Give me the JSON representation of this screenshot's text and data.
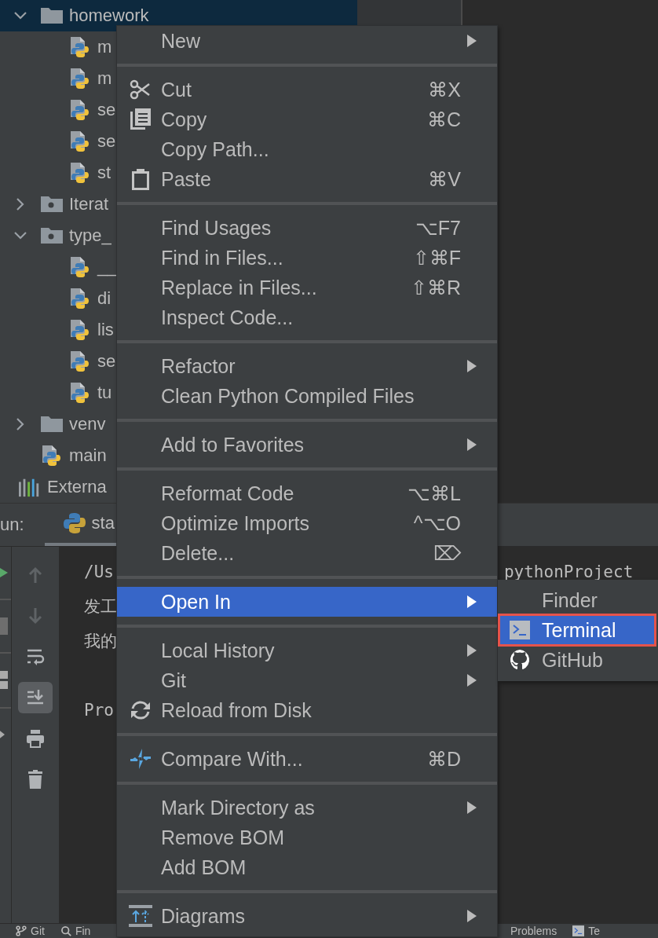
{
  "project_tree": {
    "rows": [
      {
        "label": "homework",
        "kind": "folder",
        "expanded": true,
        "selected": true,
        "children": [
          {
            "label": "m",
            "kind": "python-file",
            "selected": false
          },
          {
            "label": "m",
            "kind": "python-file",
            "selected": false
          },
          {
            "label": "se",
            "kind": "python-file",
            "selected": false
          },
          {
            "label": "se",
            "kind": "python-file",
            "selected": false
          },
          {
            "label": "st",
            "kind": "python-file",
            "selected": false
          }
        ]
      },
      {
        "label": "Iterat",
        "kind": "package",
        "expanded": false,
        "selected": false
      },
      {
        "label": "type_",
        "kind": "package",
        "expanded": true,
        "selected": false,
        "children": [
          {
            "label": "__",
            "kind": "python-file",
            "selected": false
          },
          {
            "label": "di",
            "kind": "python-file",
            "selected": false
          },
          {
            "label": "lis",
            "kind": "python-file",
            "selected": false
          },
          {
            "label": "se",
            "kind": "python-file",
            "selected": false
          },
          {
            "label": "tu",
            "kind": "python-file",
            "selected": false
          }
        ]
      },
      {
        "label": "venv",
        "kind": "folder",
        "expanded": false,
        "selected": false
      },
      {
        "label": "main",
        "kind": "python-file",
        "selected": false
      },
      {
        "label": "Externa",
        "kind": "libraries",
        "selected": false
      }
    ]
  },
  "run_panel": {
    "label": "un:",
    "tab": "sta",
    "toolbar": [
      {
        "kind": "up",
        "disabled": true
      },
      {
        "kind": "down",
        "disabled": true
      },
      {
        "kind": "wrap",
        "on": false
      },
      {
        "kind": "scroll-end",
        "on": true
      },
      {
        "kind": "print",
        "on": false
      },
      {
        "kind": "trash",
        "on": false
      }
    ],
    "console_lines": [
      {
        "text": "/Us",
        "tail": "pythonProject"
      },
      {
        "text": "发工"
      },
      {
        "text": "我的"
      },
      {
        "text": "Pro",
        "blank_before": true
      }
    ]
  },
  "context_menu": {
    "sections": [
      [
        {
          "label": "New",
          "submenu": true,
          "selected": false
        }
      ],
      [
        {
          "label": "Cut",
          "kind": "cut",
          "shortcut": "⌘X",
          "selected": false
        },
        {
          "label": "Copy",
          "kind": "copy",
          "shortcut": "⌘C",
          "selected": false
        },
        {
          "label": "Copy Path...",
          "selected": false
        },
        {
          "label": "Paste",
          "kind": "paste",
          "shortcut": "⌘V",
          "selected": false
        }
      ],
      [
        {
          "label": "Find Usages",
          "shortcut": "⌥F7",
          "selected": false
        },
        {
          "label": "Find in Files...",
          "shortcut": "⇧⌘F",
          "selected": false
        },
        {
          "label": "Replace in Files...",
          "shortcut": "⇧⌘R",
          "selected": false
        },
        {
          "label": "Inspect Code...",
          "selected": false
        }
      ],
      [
        {
          "label": "Refactor",
          "submenu": true,
          "selected": false
        },
        {
          "label": "Clean Python Compiled Files",
          "selected": false
        }
      ],
      [
        {
          "label": "Add to Favorites",
          "submenu": true,
          "selected": false
        }
      ],
      [
        {
          "label": "Reformat Code",
          "shortcut": "⌥⌘L",
          "selected": false
        },
        {
          "label": "Optimize Imports",
          "shortcut": "^⌥O",
          "selected": false
        },
        {
          "label": "Delete...",
          "shortcut": "⌦",
          "selected": false
        }
      ],
      [
        {
          "label": "Open In",
          "submenu": true,
          "selected": true
        }
      ],
      [
        {
          "label": "Local History",
          "submenu": true,
          "selected": false
        },
        {
          "label": "Git",
          "submenu": true,
          "selected": false
        },
        {
          "label": "Reload from Disk",
          "kind": "reload",
          "selected": false
        }
      ],
      [
        {
          "label": "Compare With...",
          "kind": "compare",
          "shortcut": "⌘D",
          "selected": false
        }
      ],
      [
        {
          "label": "Mark Directory as",
          "submenu": true,
          "selected": false
        },
        {
          "label": "Remove BOM",
          "selected": false
        },
        {
          "label": "Add BOM",
          "selected": false
        }
      ],
      [
        {
          "label": "Diagrams",
          "kind": "diagrams",
          "submenu": true,
          "selected": false
        }
      ]
    ]
  },
  "submenu": {
    "items": [
      {
        "label": "Finder",
        "selected": false,
        "outlined": false
      },
      {
        "label": "Terminal",
        "kind": "terminal",
        "selected": true,
        "outlined": true
      },
      {
        "label": "GitHub",
        "kind": "github",
        "selected": false,
        "outlined": false
      }
    ]
  },
  "status_bar": {
    "left": [
      {
        "label": "Git",
        "kind": "git"
      },
      {
        "label": "Fin",
        "kind": "search"
      }
    ],
    "right": [
      {
        "label": "Problems"
      },
      {
        "label": "Te",
        "kind": "terminal"
      }
    ]
  }
}
